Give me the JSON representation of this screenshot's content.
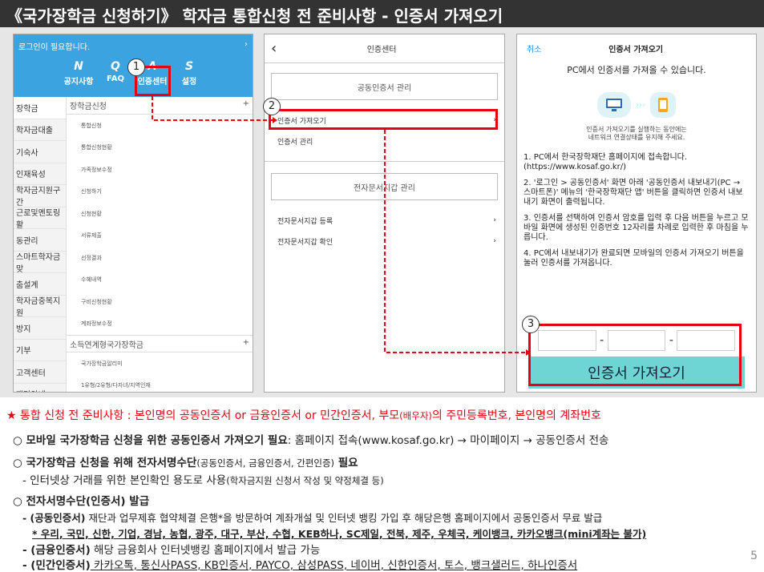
{
  "title": "《국가장학금 신청하기》 학자금 통합신청 전 준비사항 - 인증서 가져오기",
  "panel1": {
    "login_text": "로그인이 필요합니다.",
    "login_arrow": "›",
    "nav": [
      {
        "letter": "N",
        "label": "공지사항"
      },
      {
        "letter": "Q",
        "label": "FAQ"
      },
      {
        "letter": "A",
        "label": "인증센터"
      },
      {
        "letter": "S",
        "label": "설정"
      }
    ],
    "left_menu": [
      "장학금",
      "학자금대출",
      "기숙사",
      "인재육성",
      "학자금지원구간",
      "근로및멘토링활",
      "동관리",
      "스마트학자금맞",
      "춤설계",
      "학자금중복지원",
      "방지",
      "기부",
      "고객센터",
      "재단안내"
    ],
    "section_header": "장학금신청",
    "section_plus": "+",
    "submenu": [
      "통합신청",
      "통합신청현황",
      "가족정보수정",
      "신청하기",
      "신청현황",
      "서류제출",
      "선정결과",
      "수혜내역",
      "구비신청현황",
      "계좌정보수정"
    ],
    "section2_header": "소득연계형국가장학금",
    "section2_plus": "+",
    "submenu2": [
      "국가장학금알리미",
      "1유형/2유형/다자녀/지역인재"
    ]
  },
  "panel2": {
    "back": "‹",
    "title": "인증센터",
    "box1": "공동인증서 관리",
    "rows1": [
      {
        "label": "인증서 가져오기",
        "chev": "›"
      },
      {
        "label": "인증서 관리",
        "chev": ""
      }
    ],
    "box2": "전자문서지갑 관리",
    "rows2": [
      {
        "label": "전자문서지갑 등록",
        "chev": "›"
      },
      {
        "label": "전자문서지갑 확인",
        "chev": "›"
      }
    ]
  },
  "panel3": {
    "cancel": "취소",
    "title": "인증서 가져오기",
    "subtitle": "PC에서 인증서를 가져올 수 있습니다.",
    "note1": "인증서 가져오기를 실행하는 동안에는",
    "note2": "네트워크 연결상태를 유지해 주세요.",
    "steps": [
      "1. PC에서 한국장학재단 홈페이지에 접속합니다. (https://www.kosaf.go.kr/)",
      "2. '로그인 > 공동인증서' 화면 아래 '공동인증서 내보내기(PC → 스마트폰)' 메뉴의 '한국장학재단 앱' 버튼을 클릭하면 인증서 내보내기 화면이 출력됩니다.",
      "3. 인증서를 선택하여 인증서 암호를 입력 후 다음 버튼을 누르고 모바일 화면에 생성된 인증번호 12자리를 차례로 입력한 후 마침을 누릅니다.",
      "4. PC에서 내보내기가 완료되면 모바일의 인증서 가져오기 버튼을 눌러 인증서를 가져옵니다."
    ],
    "dash": "-",
    "button": "인증서 가져오기"
  },
  "callouts": [
    "1",
    "2",
    "3"
  ],
  "bottom": {
    "star_line_a": "★ 통합 신청 전 준비사항 : 본인명의 공동인증서 or 금융인증서 or 민간인증서, 부모",
    "star_line_paren": "(배우자)",
    "star_line_b": "의 주민등록번호, 본인명의 계좌번호",
    "b1_bold": "○ 모바일 국가장학금 신청을 위한 공동인증서 가져오기 필요",
    "b1_rest": ": 홈페이지 접속(www.kosaf.go.kr) → 마이페이지 → 공동인증서 전송",
    "b2_bold1": "○ 국가장학금 신청을 위해 전자서명수단",
    "b2_paren": "(공동인증서, 금융인증서, 간편인증)",
    "b2_bold2": " 필요",
    "b2_sub_a": "- 인터넷상 거래를 위한 본인확인 용도로 사용",
    "b2_sub_paren": "(학자금지원 신청서 작성 및 약정체결 등)",
    "b3_bold": "○ 전자서명수단(인증서) 발급",
    "b3_l1_bold": "- (공동인증서)",
    "b3_l1_rest": " 재단과 업무제휴 협약체결 은행*을 방문하여 계좌개설 및 인터넷 뱅킹 가입 후 해당은행 홈페이지에서 공동인증서 무료 발급",
    "b3_l2": "* 우리, 국민, 신한, 기업, 경남, 농협, 광주, 대구, 부산, 수협, KEB하나, SC제일, 전북, 제주, 우체국, 케이뱅크, 카카오뱅크(mini계좌는 불가)",
    "b3_l3_bold": "- (금융인증서)",
    "b3_l3_rest": " 해당 금융회사 인터넷뱅킹 홈페이지에서 발급 가능",
    "b3_l4_bold": "- (민간인증서)",
    "b3_l4_rest": " 카카오톡, 통신사PASS, KB인증서, PAYCO, 삼성PASS, 네이버, 신한인증서, 토스, 뱅크샐러드, 하나인증서",
    "page": "5"
  }
}
